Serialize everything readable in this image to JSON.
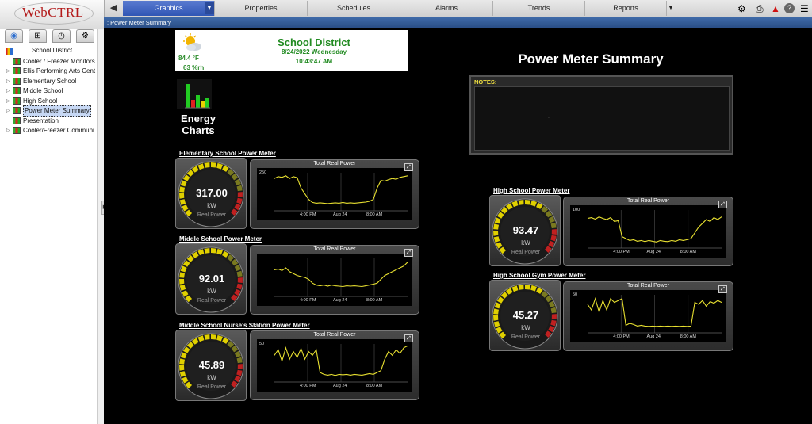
{
  "app": {
    "logo": "WebCTRL"
  },
  "nav": {
    "tabs": [
      "Graphics",
      "Properties",
      "Schedules",
      "Alarms",
      "Trends",
      "Reports"
    ],
    "tool_icons": [
      "steering-wheel-icon",
      "printer-icon",
      "alarm-warning-icon",
      "help-icon",
      "menu-icon"
    ]
  },
  "breadcrumb": ": Power Meter Summary",
  "sidebar": {
    "tabs": [
      "geographic-tree-icon",
      "network-tree-icon",
      "schedule-tree-icon",
      "config-tree-icon"
    ],
    "root": "School District",
    "items": [
      {
        "label": "Cooler / Freezer Monitors",
        "has_arrow": false
      },
      {
        "label": "Ellis Performing Arts Cent",
        "has_arrow": true
      },
      {
        "label": "Elementary School",
        "has_arrow": true
      },
      {
        "label": "Middle School",
        "has_arrow": true
      },
      {
        "label": "High School",
        "has_arrow": true
      },
      {
        "label": "Power Meter Summary",
        "has_arrow": true,
        "selected": true
      },
      {
        "label": "Presentation",
        "has_arrow": false
      },
      {
        "label": "Cooler/Freezer Communi",
        "has_arrow": true
      }
    ]
  },
  "header": {
    "title": "School District",
    "date": "8/24/2022 Wednesday",
    "time": "10:43:47 AM",
    "temperature": "84.4 °F",
    "humidity": "63 %rh"
  },
  "energy_charts_label": "Energy Charts",
  "page_title": "Power Meter Summary",
  "notes": {
    "label": "NOTES:",
    "text": "."
  },
  "meters": [
    {
      "title": "Elementary School Power Meter",
      "value": "317.00",
      "unit": "kW",
      "caption": "Real Power",
      "trend_title": "Total Real Power",
      "ymax_label": "250",
      "ticks": [
        "4:00 PM",
        "Aug 24",
        "8:00 AM"
      ],
      "trend": [
        0.85,
        0.9,
        0.88,
        0.92,
        0.85,
        0.9,
        0.87,
        0.6,
        0.45,
        0.3,
        0.22,
        0.2,
        0.21,
        0.2,
        0.19,
        0.2,
        0.21,
        0.2,
        0.22,
        0.2,
        0.21,
        0.2,
        0.21,
        0.22,
        0.23,
        0.25,
        0.3,
        0.6,
        0.8,
        0.78,
        0.82,
        0.85,
        0.83,
        0.88,
        0.9,
        0.92
      ]
    },
    {
      "title": "Middle School Power Meter",
      "value": "92.01",
      "unit": "kW",
      "caption": "Real Power",
      "trend_title": "Total Real Power",
      "ymax_label": "",
      "ticks": [
        "4:00 PM",
        "Aug 24",
        "8:00 AM"
      ],
      "trend": [
        0.7,
        0.72,
        0.68,
        0.75,
        0.65,
        0.6,
        0.55,
        0.52,
        0.5,
        0.45,
        0.35,
        0.3,
        0.28,
        0.3,
        0.27,
        0.3,
        0.28,
        0.27,
        0.26,
        0.28,
        0.27,
        0.28,
        0.27,
        0.26,
        0.28,
        0.3,
        0.32,
        0.35,
        0.45,
        0.55,
        0.6,
        0.65,
        0.7,
        0.75,
        0.8,
        0.9
      ]
    },
    {
      "title": "Middle School Nurse's Station Power Meter",
      "value": "45.89",
      "unit": "kW",
      "caption": "Real Power",
      "trend_title": "Total Real Power",
      "ymax_label": "50",
      "ticks": [
        "4:00 PM",
        "Aug 24",
        "8:00 AM"
      ],
      "trend": [
        0.7,
        0.85,
        0.55,
        0.9,
        0.6,
        0.8,
        0.65,
        0.88,
        0.6,
        0.8,
        0.7,
        0.85,
        0.25,
        0.2,
        0.18,
        0.2,
        0.17,
        0.2,
        0.19,
        0.2,
        0.18,
        0.2,
        0.19,
        0.18,
        0.2,
        0.22,
        0.2,
        0.25,
        0.3,
        0.6,
        0.8,
        0.7,
        0.85,
        0.75,
        0.9,
        0.95
      ]
    },
    {
      "title": "High School Power Meter",
      "value": "93.47",
      "unit": "kW",
      "caption": "Real Power",
      "trend_title": "Total Real Power",
      "ymax_label": "100",
      "ticks": [
        "4:00 PM",
        "Aug 24",
        "8:00 AM"
      ],
      "trend": [
        0.78,
        0.8,
        0.76,
        0.82,
        0.78,
        0.75,
        0.8,
        0.7,
        0.72,
        0.3,
        0.25,
        0.2,
        0.22,
        0.18,
        0.2,
        0.17,
        0.2,
        0.18,
        0.16,
        0.2,
        0.18,
        0.17,
        0.2,
        0.18,
        0.22,
        0.2,
        0.22,
        0.25,
        0.4,
        0.55,
        0.65,
        0.75,
        0.7,
        0.8,
        0.75,
        0.82
      ]
    },
    {
      "title": "High School Gym Power Meter",
      "value": "45.27",
      "unit": "kW",
      "caption": "Real Power",
      "trend_title": "Total Real Power",
      "ymax_label": "50",
      "ticks": [
        "4:00 PM",
        "Aug 24",
        "8:00 AM"
      ],
      "trend": [
        0.75,
        0.6,
        0.9,
        0.55,
        0.85,
        0.6,
        0.9,
        0.8,
        0.85,
        0.9,
        0.2,
        0.25,
        0.22,
        0.18,
        0.2,
        0.18,
        0.17,
        0.18,
        0.17,
        0.18,
        0.17,
        0.18,
        0.17,
        0.18,
        0.17,
        0.18,
        0.17,
        0.18,
        0.8,
        0.75,
        0.85,
        0.7,
        0.82,
        0.78,
        0.85,
        0.8
      ]
    }
  ],
  "colors": {
    "trend_line": "#e8e030",
    "title_green": "#228b22",
    "gauge_yellow": "#e0d000",
    "gauge_red": "#c02020"
  }
}
